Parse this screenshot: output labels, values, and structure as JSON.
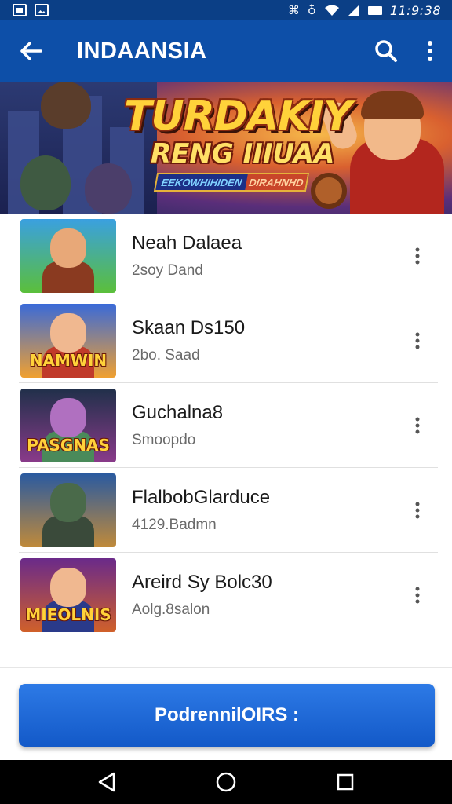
{
  "status_bar": {
    "time": "11:9:38",
    "glyph_icons": [
      "⌘",
      "♁",
      "⚙"
    ]
  },
  "app_bar": {
    "title": "INDAANSIA",
    "back_icon": "arrow-left-icon",
    "search_icon": "search-icon",
    "menu_icon": "more-vertical-icon"
  },
  "banner": {
    "title": "TURDAKIY",
    "subtitle": "RENG IIIUAA",
    "tag_left": "EEKOWHIHIDEN",
    "tag_right": "DIRAHNHD"
  },
  "list": {
    "items": [
      {
        "title": "Neah Dalaea",
        "subtitle": "2soy Dand",
        "thumb_label": "",
        "colors": {
          "bg1": "#3aa0e0",
          "bg2": "#5bbf3a",
          "skin": "#e8a878",
          "body": "#8a3a20"
        }
      },
      {
        "title": "Skaan Ds150",
        "subtitle": "2bo. Saad",
        "thumb_label": "NAMWIN",
        "colors": {
          "bg1": "#3a6ad8",
          "bg2": "#f0a030",
          "skin": "#f0b890",
          "body": "#c03a2a"
        }
      },
      {
        "title": "Guchalna8",
        "subtitle": "Smoopdo",
        "thumb_label": "PASGNAS",
        "colors": {
          "bg1": "#20304a",
          "bg2": "#8a3a8a",
          "skin": "#b070c0",
          "body": "#4a8a5a"
        }
      },
      {
        "title": "FlalbobGlarduce",
        "subtitle": "4129.Badmn",
        "thumb_label": "",
        "colors": {
          "bg1": "#2a5aa0",
          "bg2": "#c08a3a",
          "skin": "#4a6a4a",
          "body": "#3a4a3a"
        }
      },
      {
        "title": "Areird Sy Bolc30",
        "subtitle": "Aolg.8salon",
        "thumb_label": "MIEOLNIS",
        "colors": {
          "bg1": "#6a2a8a",
          "bg2": "#d0602a",
          "skin": "#f0b890",
          "body": "#2a3a8a"
        }
      }
    ]
  },
  "primary_button": {
    "label": "PodrennilOIRS :"
  },
  "nav_bar": {
    "back_icon": "nav-back-icon",
    "home_icon": "nav-home-icon",
    "recents_icon": "nav-recents-icon"
  },
  "colors": {
    "app_bar": "#0d4fa8",
    "status_bar": "#0b3f86",
    "primary": "#1e6bd6"
  }
}
